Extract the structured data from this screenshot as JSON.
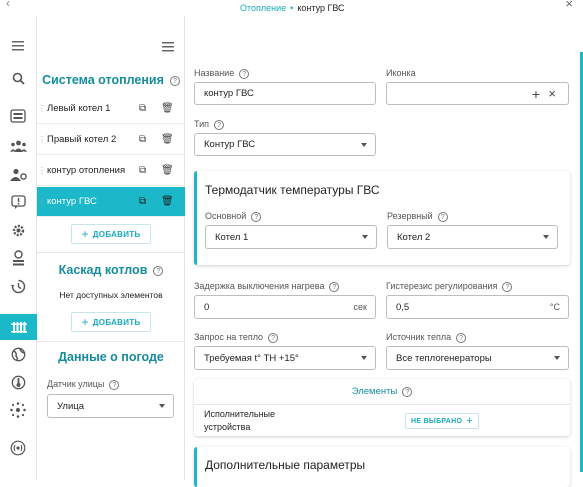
{
  "breadcrumb": {
    "parent": "Отопление",
    "separator": "•",
    "current": "контур ГВС"
  },
  "rail": {
    "icons": [
      "hamburger-icon",
      "search-icon",
      "controller-icon",
      "users-icon",
      "user-settings-icon",
      "alert-icon",
      "gear-icon",
      "sensor-icon",
      "history-icon",
      "radiator-icon",
      "globe-icon",
      "thermometer-icon",
      "network-icon",
      "radio-icon"
    ],
    "active": "radiator-icon"
  },
  "sidebar": {
    "heating_title": "Система отопления",
    "heating_items": [
      {
        "label": "Левый котел 1",
        "active": false
      },
      {
        "label": "Правый котел 2",
        "active": false
      },
      {
        "label": "контур отопления",
        "active": false
      },
      {
        "label": "контур ГВС",
        "active": true
      }
    ],
    "add_label": "ДОБАВИТЬ",
    "cascade_title": "Каскад котлов",
    "cascade_empty": "Нет доступных элементов",
    "cascade_add_label": "ДОБАВИТЬ",
    "weather_title": "Данные о погоде",
    "street_sensor_label": "Датчик улицы",
    "street_sensor_value": "Улица"
  },
  "form": {
    "name_label": "Название",
    "name_value": "контур ГВС",
    "icon_label": "Иконка",
    "type_label": "Тип",
    "type_value": "Контур ГВС",
    "sensor_card": {
      "title": "Термодатчик температуры ГВС",
      "main_label": "Основной",
      "main_value": "Котел 1",
      "reserve_label": "Резервный",
      "reserve_value": "Котел 2"
    },
    "delay_label": "Задержка выключения нагрева",
    "delay_value": "0",
    "delay_unit": "сек",
    "hysteresis_label": "Гистерезис регулирования",
    "hysteresis_value": "0,5",
    "hysteresis_unit": "°C",
    "heat_request_label": "Запрос на тепло",
    "heat_request_value": "Требуемая t° ТН +15°",
    "heat_source_label": "Источник тепла",
    "heat_source_value": "Все теплогенераторы",
    "elements_title": "Элементы",
    "actuators_label_1": "Исполнительные",
    "actuators_label_2": "устройства",
    "not_selected_label": "НЕ ВЫБРАНО",
    "extra_title": "Дополнительные параметры"
  },
  "colors": {
    "accent": "#1ab8c8",
    "accent_text": "#168c9c"
  }
}
